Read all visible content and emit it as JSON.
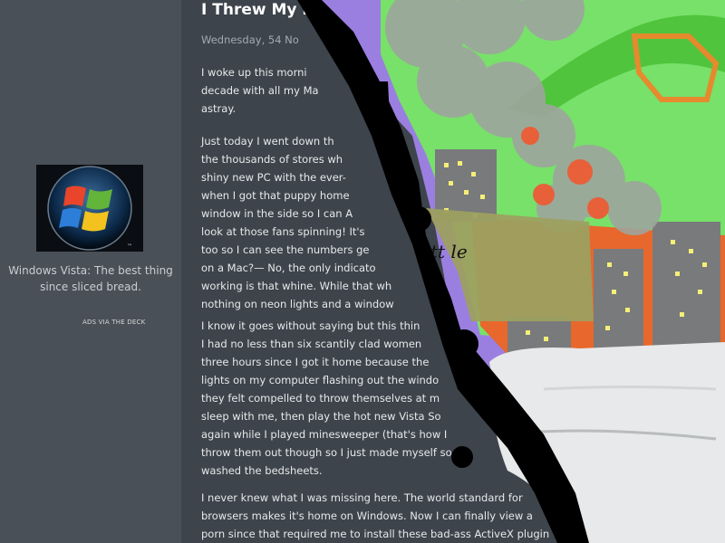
{
  "sidebar": {
    "ad_caption": "Windows Vista: The best thing since sliced bread.",
    "ad_via": "ADS VIA THE DECK"
  },
  "post": {
    "title": "I Threw My M",
    "date": "Wednesday, 54 No",
    "paragraphs": [
      {
        "lines": [
          "I woke up this morni",
          "decade with all my Ma",
          "astray."
        ]
      },
      {
        "lines": [
          "Just today I went down th",
          "the thousands of stores wh",
          "shiny new PC with the ever-",
          "when I got that puppy home",
          "window in the side so I can A",
          "look at those fans spinning! It's",
          "too so I can see the numbers ge",
          "on a Mac?— No, the only indicato",
          "working is that whine. While that wh",
          "nothing on neon lights and a window"
        ]
      },
      {
        "lines": [
          "I know it goes without saying but this thin",
          "I had no less than six scantily clad women",
          "three hours since I got it home because the",
          "lights on my computer flashing out the windo",
          "they felt compelled to throw themselves at m",
          "sleep with me, then play the hot new Vista So",
          "again while I played minesweeper (that's how I",
          "throw them out though so I just made myself so",
          "washed the bedsheets."
        ]
      },
      {
        "lines": [
          "I never knew what I was missing here. The world standard for",
          "browsers makes it's home on Windows. Now I can finally view a",
          "porn since that required me to install these bad-ass ActiveX plugin"
        ]
      }
    ]
  },
  "drawing": {
    "sign_text": "tt le",
    "colors": {
      "sky": "#9b7fe0",
      "grass": "#77e16a",
      "smoke": "#9ea59d",
      "fire": "#e8603a",
      "building": "#787a7c",
      "window_light": "#f5ef76",
      "ink": "#000000"
    }
  }
}
